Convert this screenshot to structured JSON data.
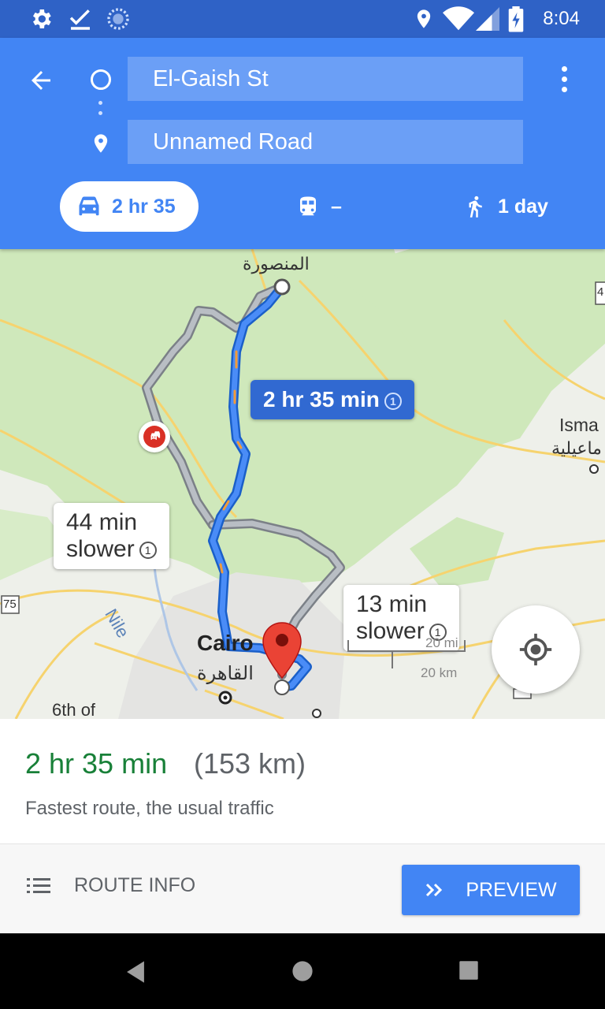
{
  "status_bar": {
    "time": "8:04",
    "left_icons": [
      "gear-icon",
      "check-icon",
      "sync-icon"
    ],
    "right_icons": [
      "location-icon",
      "wifi-icon",
      "signal-icon",
      "battery-icon"
    ]
  },
  "header": {
    "from_value": "El-Gaish St",
    "to_value": "Unnamed Road",
    "modes": {
      "drive": "2 hr 35",
      "transit": "–",
      "walk": "1 day"
    }
  },
  "map": {
    "labels": {
      "mansoura": "المنصورة",
      "ismailia_en": "Isma",
      "ismailia_ar": "ماعيلية",
      "cairo_en": "Cairo",
      "cairo_ar": "القاهرة",
      "nile": "Nile",
      "sixth": "6th of",
      "road_75": "75",
      "road_4": "4"
    },
    "bubbles": {
      "primary": "2 hr 35 min",
      "alt1_line1": "44 min",
      "alt1_line2": "slower",
      "alt2_line1": "13 min",
      "alt2_line2": "slower"
    },
    "scale": {
      "mi": "20 mi",
      "km": "20 km"
    },
    "colors": {
      "primary_route": "#4285f4",
      "alt_route": "#a0a6ad",
      "green_area": "#c9e6b3",
      "road": "#f8d779"
    }
  },
  "route": {
    "time": "2 hr 35 min",
    "distance": "(153 km)",
    "description": "Fastest route, the usual traffic"
  },
  "actions": {
    "route_info": "ROUTE INFO",
    "preview": "PREVIEW"
  }
}
